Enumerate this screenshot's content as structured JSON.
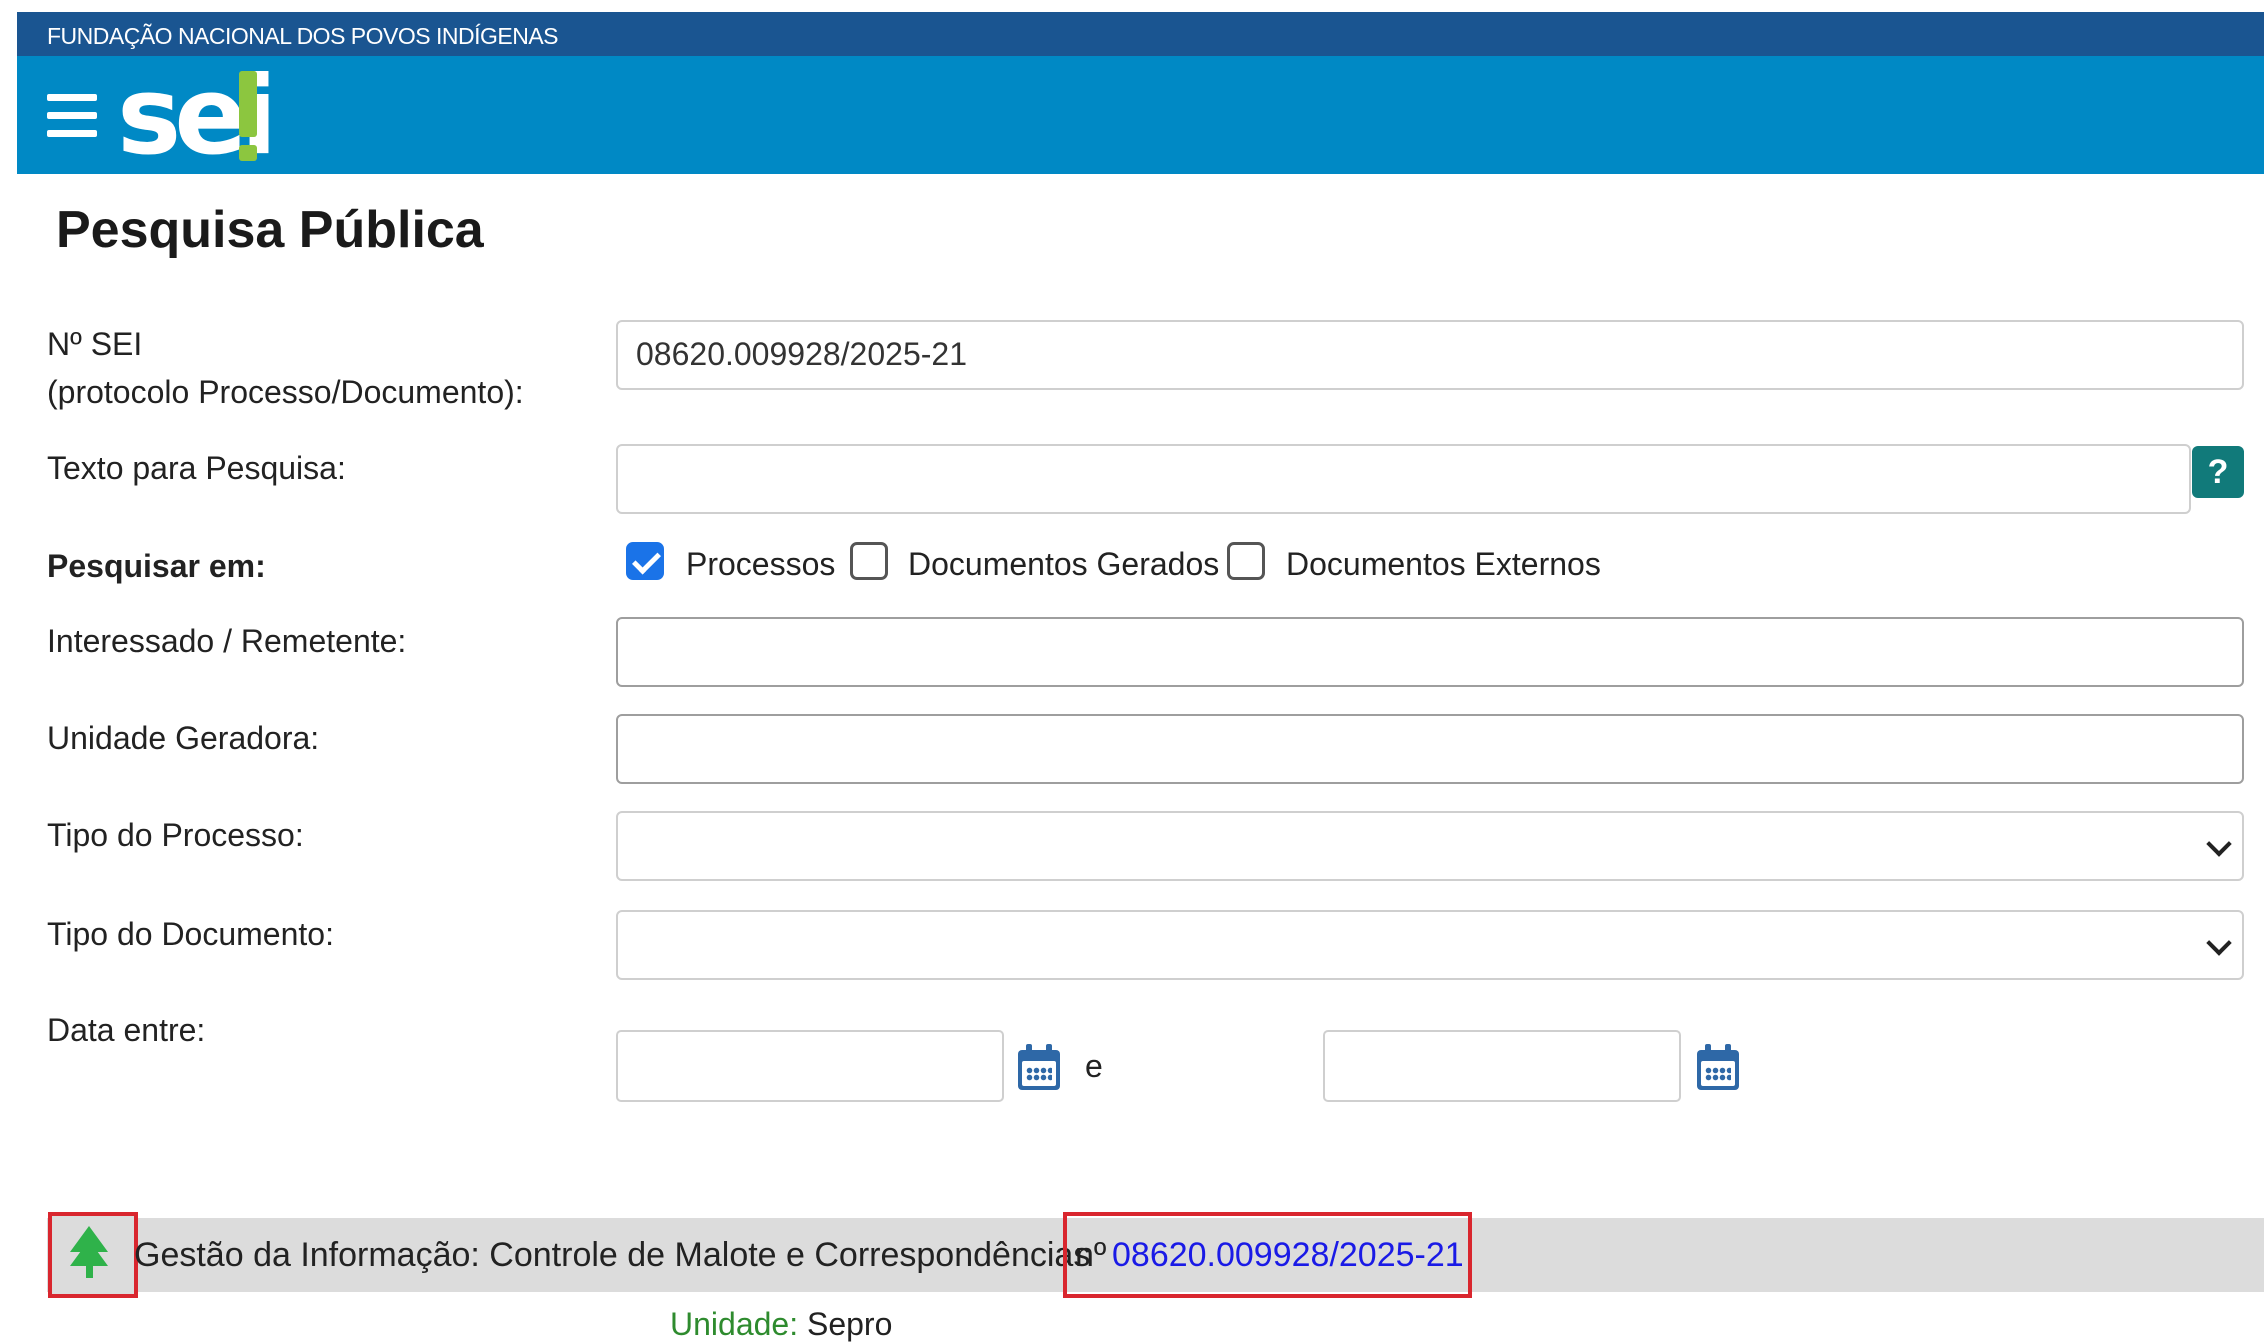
{
  "header": {
    "org_name": "FUNDAÇÃO NACIONAL DOS POVOS INDÍGENAS",
    "logo_text": "sei",
    "colors": {
      "top_strip": "#1a5591",
      "navbar": "#0089c5",
      "logo_accent": "#8cc63f"
    }
  },
  "page": {
    "title": "Pesquisa Pública"
  },
  "form": {
    "sei_label_line1": "Nº SEI",
    "sei_label_line2": "(protocolo Processo/Documento):",
    "sei_value": "08620.009928/2025-21",
    "texto_label": "Texto para Pesquisa:",
    "texto_value": "",
    "help_symbol": "?",
    "pesquisar_label": "Pesquisar em:",
    "checkboxes": [
      {
        "label": "Processos",
        "checked": true
      },
      {
        "label": "Documentos Gerados",
        "checked": false
      },
      {
        "label": "Documentos Externos",
        "checked": false
      }
    ],
    "interessado_label": "Interessado / Remetente:",
    "unidade_label": "Unidade Geradora:",
    "tipo_processo_label": "Tipo do Processo:",
    "tipo_documento_label": "Tipo do Documento:",
    "data_label": "Data entre:",
    "data_separator": "e"
  },
  "result": {
    "title": "Gestão da Informação: Controle de Malote e Correspondências",
    "number_prefix": "nº",
    "number": "08620.009928/2025-21",
    "unit_label": "Unidade:",
    "unit_value": "Sepro",
    "colors": {
      "highlight": "#d9262e",
      "link": "#1a1ae6",
      "tree": "#2fb24a"
    }
  }
}
